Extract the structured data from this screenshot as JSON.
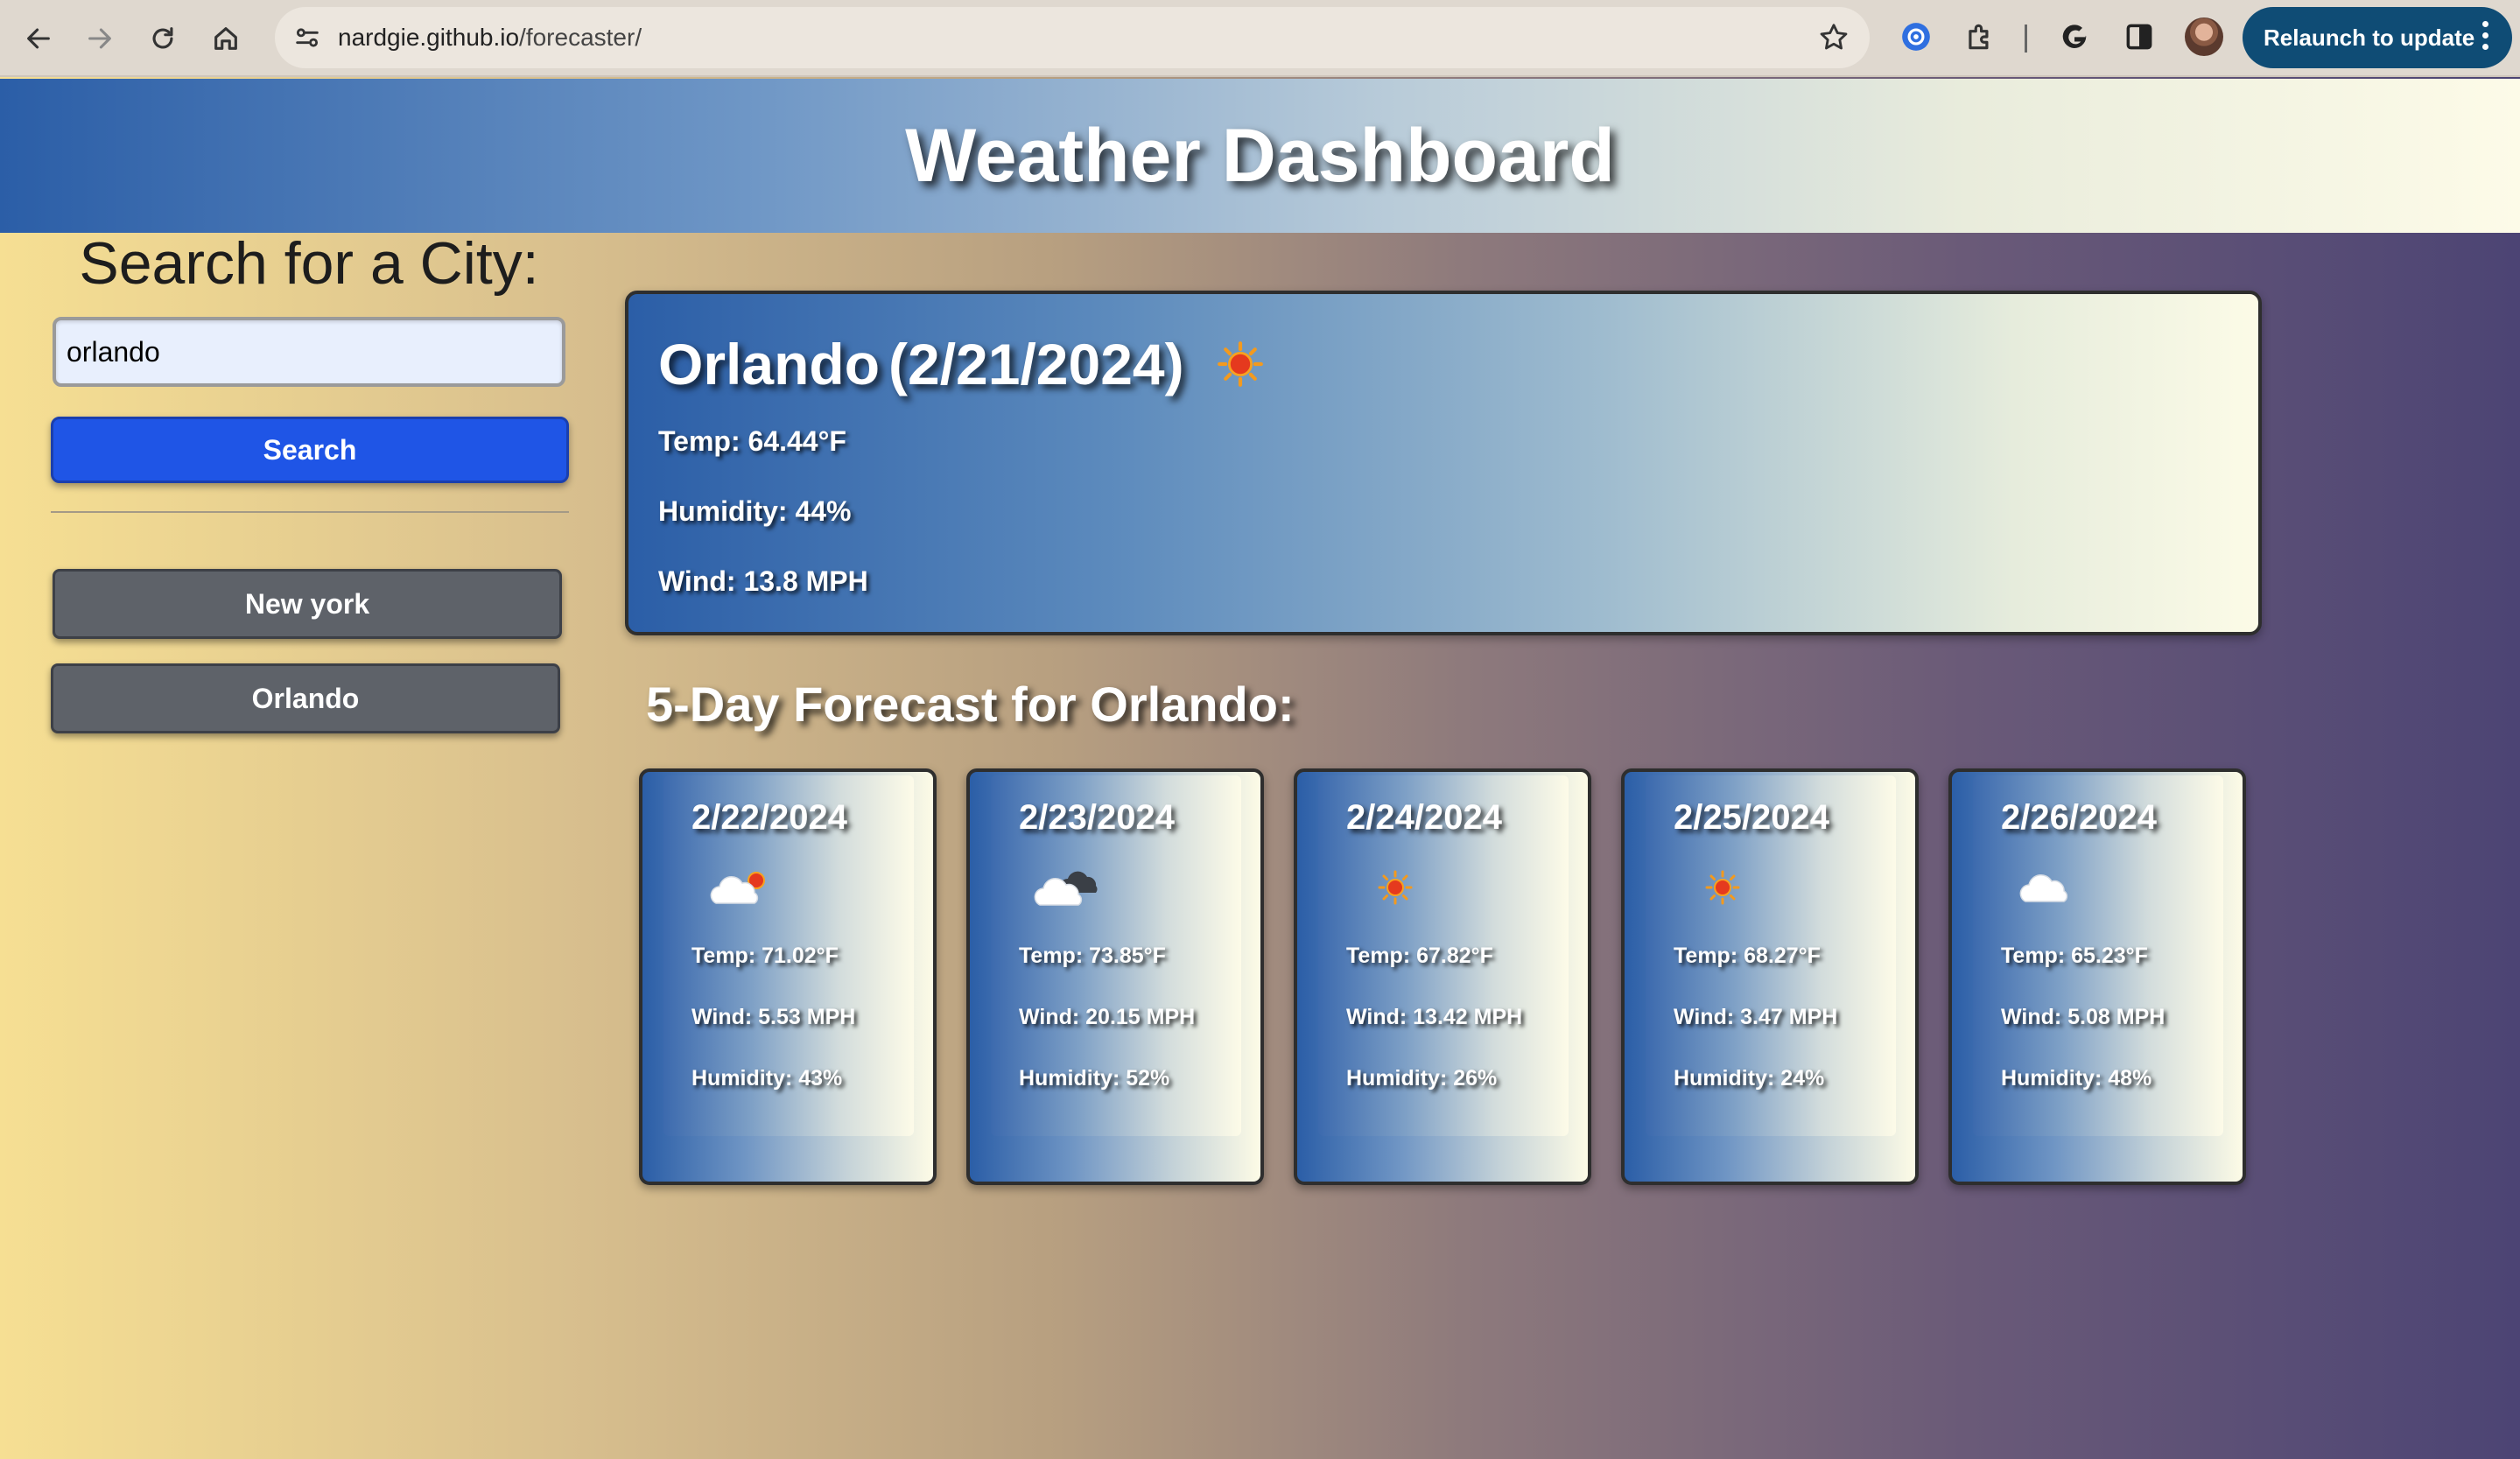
{
  "browser": {
    "url_host": "nardgie.github.io",
    "url_path": "/forecaster/",
    "relaunch_label": "Relaunch to update",
    "icons": [
      "back-icon",
      "forward-icon",
      "reload-icon",
      "home-icon",
      "site-settings-icon",
      "bookmark-star-icon",
      "extension-icon",
      "puzzle-icon",
      "google-icon",
      "sidepanel-icon",
      "profile-avatar",
      "menu-dots-icon"
    ]
  },
  "header": {
    "title": "Weather Dashboard"
  },
  "sidebar": {
    "search_title": "Search for a City:",
    "search_value": "orlando",
    "search_button": "Search",
    "history": [
      "New york",
      "Orlando"
    ]
  },
  "current": {
    "city": "Orlando",
    "date": "(2/21/2024)",
    "icon": "sun-icon",
    "temp": "Temp: 64.44°F",
    "humidity": "Humidity: 44%",
    "wind": "Wind: 13.8 MPH"
  },
  "forecast": {
    "title": "5-Day Forecast for Orlando:",
    "days": [
      {
        "date": "2/22/2024",
        "icon": "partly-cloudy-icon",
        "temp": "Temp: 71.02°F",
        "wind": "Wind: 5.53 MPH",
        "humidity": "Humidity: 43%"
      },
      {
        "date": "2/23/2024",
        "icon": "broken-clouds-icon",
        "temp": "Temp: 73.85°F",
        "wind": "Wind: 20.15 MPH",
        "humidity": "Humidity: 52%"
      },
      {
        "date": "2/24/2024",
        "icon": "sun-icon",
        "temp": "Temp: 67.82°F",
        "wind": "Wind: 13.42 MPH",
        "humidity": "Humidity: 26%"
      },
      {
        "date": "2/25/2024",
        "icon": "sun-icon",
        "temp": "Temp: 68.27°F",
        "wind": "Wind: 3.47 MPH",
        "humidity": "Humidity: 24%"
      },
      {
        "date": "2/26/2024",
        "icon": "cloud-icon",
        "temp": "Temp: 65.23°F",
        "wind": "Wind: 5.08 MPH",
        "humidity": "Humidity: 48%"
      }
    ]
  },
  "colors": {
    "search_button": "#1f55e6",
    "history_button": "#5e6269",
    "relaunch_button": "#0f4c75",
    "card_gradient_start": "#2b5ea7",
    "card_gradient_end": "#fdfbe6"
  }
}
